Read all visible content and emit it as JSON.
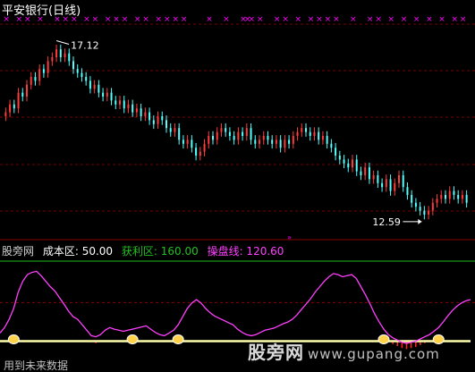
{
  "chart_title": "平安银行(日线)",
  "colors": {
    "up": "#ff3c3c",
    "down": "#54ffff",
    "grid": "#7a0000",
    "cross": "#ff00ff",
    "cost": "#ffffff",
    "profit": "#22c022",
    "control": "#ff40ff",
    "baseline": "#ffffaa"
  },
  "indicator": {
    "name": "股旁网",
    "cost_label": "成本区: 50.00",
    "profit_label": "获利区: 160.00",
    "control_label": "操盘线: 120.60"
  },
  "watermark": {
    "brand": "股旁网",
    "url": "www.gupang.com"
  },
  "footnote": "用到未来数据",
  "chart_data": [
    {
      "type": "candlestick",
      "title": "平安银行(日线)",
      "annotations": [
        {
          "text": "17.12",
          "label_for": "high",
          "value": 17.12
        },
        {
          "text": "12.59",
          "label_for": "low",
          "value": 12.59
        }
      ],
      "ylim": [
        12.2,
        17.7
      ],
      "grid": "horizontal dashed",
      "close": [
        15.3,
        15.5,
        15.4,
        15.8,
        15.7,
        16.0,
        16.2,
        16.1,
        16.4,
        16.3,
        16.6,
        16.7,
        16.9,
        16.7,
        16.8,
        16.6,
        16.4,
        16.3,
        16.2,
        16.1,
        15.9,
        16.0,
        15.8,
        15.7,
        15.8,
        15.6,
        15.5,
        15.6,
        15.4,
        15.5,
        15.3,
        15.4,
        15.2,
        15.3,
        15.1,
        15.0,
        15.2,
        15.1,
        14.9,
        14.8,
        14.9,
        14.6,
        14.5,
        14.6,
        14.4,
        14.2,
        14.3,
        14.5,
        14.7,
        14.6,
        14.8,
        14.9,
        14.8,
        14.7,
        14.6,
        14.8,
        14.7,
        14.9,
        14.6,
        14.5,
        14.6,
        14.7,
        14.6,
        14.5,
        14.6,
        14.4,
        14.6,
        14.5,
        14.7,
        14.8,
        14.9,
        14.8,
        14.7,
        14.8,
        14.6,
        14.7,
        14.5,
        14.4,
        14.2,
        14.1,
        14.0,
        13.9,
        14.1,
        13.8,
        13.7,
        13.9,
        13.6,
        13.7,
        13.5,
        13.4,
        13.6,
        13.3,
        13.5,
        13.7,
        13.4,
        13.2,
        13.0,
        12.9,
        12.8,
        12.7,
        12.8,
        13.0,
        13.1,
        13.2,
        13.1,
        13.3,
        13.2,
        13.1,
        13.2,
        13.0
      ]
    },
    {
      "type": "line",
      "title": "股旁网",
      "ylim": [
        0,
        200
      ],
      "series": [
        {
          "name": "获利区",
          "values": [
            65,
            75,
            90,
            110,
            140,
            160,
            172,
            176,
            178,
            170,
            160,
            150,
            142,
            130,
            118,
            105,
            95,
            90,
            80,
            70,
            60,
            58,
            62,
            70,
            75,
            72,
            70,
            68,
            70,
            72,
            74,
            76,
            78,
            72,
            66,
            62,
            60,
            65,
            70,
            80,
            95,
            110,
            120,
            126,
            120,
            110,
            102,
            96,
            92,
            88,
            84,
            80,
            72,
            66,
            62,
            60,
            62,
            66,
            70,
            72,
            74,
            78,
            82,
            85,
            90,
            98,
            108,
            118,
            128,
            140,
            150,
            160,
            168,
            174,
            172,
            168,
            170,
            172,
            165,
            150,
            135,
            118,
            100,
            85,
            72,
            62,
            56,
            52,
            48,
            46,
            48,
            50,
            54,
            58,
            62,
            68,
            75,
            85,
            96,
            106,
            114,
            120,
            124,
            126
          ]
        },
        {
          "name": "成本区",
          "values": [
            50,
            50,
            50,
            50,
            50,
            50,
            50,
            50,
            50,
            50,
            50,
            50,
            50,
            50,
            50,
            50,
            50,
            50,
            50,
            50,
            50,
            50,
            50,
            50,
            50,
            50,
            50,
            50,
            50,
            50,
            50,
            50,
            50,
            50,
            50,
            50,
            50,
            50,
            50,
            50,
            50,
            50,
            50,
            50,
            50,
            50,
            50,
            50,
            50,
            50,
            50,
            50,
            50,
            50,
            50,
            50,
            50,
            50,
            50,
            50,
            50,
            50,
            50,
            50,
            50,
            50,
            50,
            50,
            50,
            50,
            50,
            50,
            50,
            50,
            50,
            50,
            50,
            50,
            50,
            50,
            50,
            50,
            50,
            50,
            50,
            50,
            50,
            50,
            50,
            50,
            50,
            50,
            50,
            50,
            50,
            50,
            50,
            50,
            50,
            50,
            50,
            50,
            50,
            50
          ]
        }
      ]
    }
  ]
}
